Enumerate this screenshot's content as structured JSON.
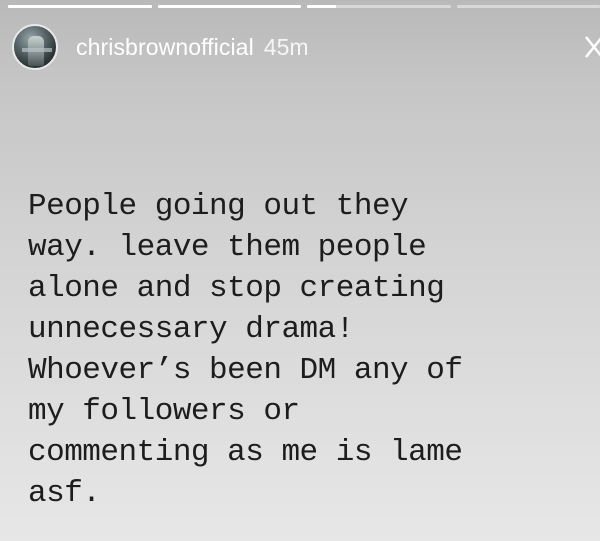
{
  "story": {
    "progress_segments": [
      {
        "state": "viewed"
      },
      {
        "state": "viewed"
      },
      {
        "state": "current",
        "progress": 0.2
      },
      {
        "state": "upcoming"
      }
    ],
    "header": {
      "avatar_icon": "profile-avatar",
      "username": "chrisbrownofficial",
      "timestamp": "45m",
      "close_icon": "close-icon"
    },
    "text_lines": [
      "People going out they",
      "way. leave them people",
      "alone and stop creating",
      "unnecessary drama!",
      "Whoever’s been DM any of",
      "my followers or",
      "commenting as me is lame",
      "asf."
    ]
  },
  "colors": {
    "text": "#1d1d1d",
    "header_text": "#ffffff",
    "background_top": "#b9b9b9",
    "background_bottom": "#e7e7e7"
  }
}
